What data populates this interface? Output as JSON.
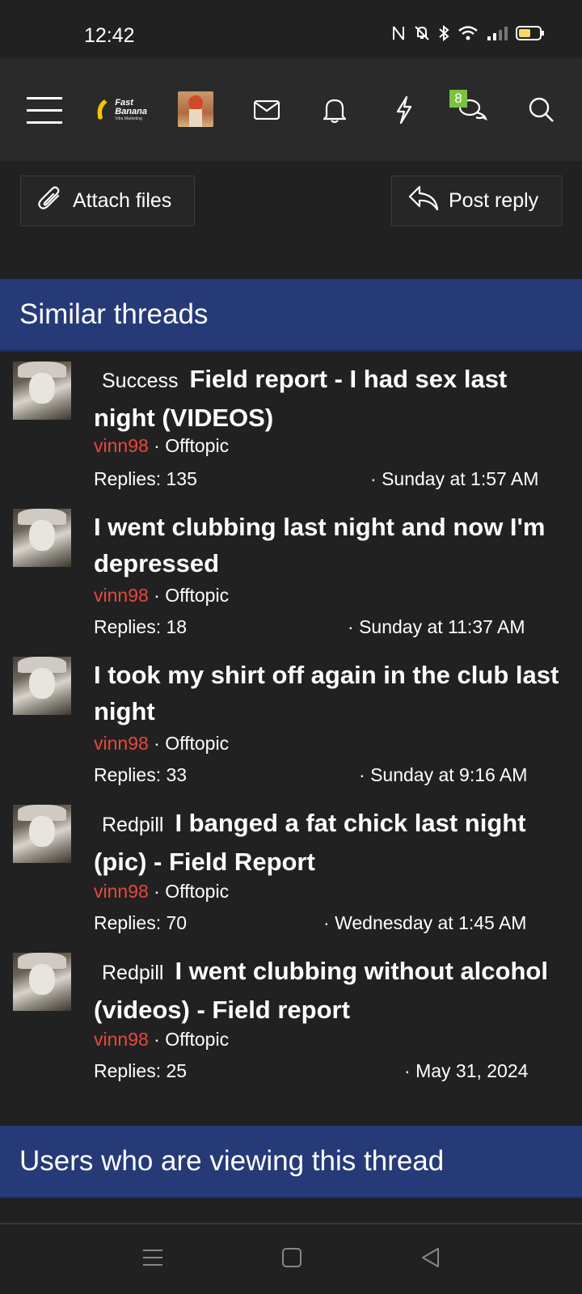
{
  "status_bar": {
    "time": "12:42",
    "icons": [
      "nfc-icon",
      "mute-icon",
      "bluetooth-icon",
      "wifi-icon",
      "signal-icon",
      "battery-icon"
    ]
  },
  "navbar": {
    "logo_text": "Fast Banana",
    "logo_subtext": "Vitra Marketing",
    "conversations_badge": "8",
    "icons": [
      "menu-icon",
      "inbox-icon",
      "bell-icon",
      "lightning-icon",
      "conversations-icon",
      "search-icon"
    ]
  },
  "actions": {
    "attach_files": "Attach files",
    "post_reply": "Post reply"
  },
  "similar_threads": {
    "heading": "Similar threads",
    "threads": [
      {
        "prefix": "Success",
        "title": "Field report - I had sex last night (VIDEOS)",
        "author": "vinn98",
        "forum": "Offtopic",
        "replies": "Replies: 135",
        "date": "Sunday at 1:57 AM"
      },
      {
        "prefix": "",
        "title": "I went clubbing last night and now I'm depressed",
        "author": "vinn98",
        "forum": "Offtopic",
        "replies": "Replies: 18",
        "date": "Sunday at 11:37 AM"
      },
      {
        "prefix": "",
        "title": "I took my shirt off again in the club last night",
        "author": "vinn98",
        "forum": "Offtopic",
        "replies": "Replies: 33",
        "date": "Sunday at 9:16 AM"
      },
      {
        "prefix": "Redpill",
        "title": "I banged a fat chick last night (pic) - Field Report",
        "author": "vinn98",
        "forum": "Offtopic",
        "replies": "Replies: 70",
        "date": "Wednesday at 1:45 AM"
      },
      {
        "prefix": "Redpill",
        "title": "I went clubbing without alcohol (videos) - Field report",
        "author": "vinn98",
        "forum": "Offtopic",
        "replies": "Replies: 25",
        "date": "May 31, 2024"
      }
    ]
  },
  "users_viewing": {
    "heading": "Users who are viewing this thread"
  },
  "colors": {
    "background": "#212121",
    "navbar": "#2a2a2a",
    "block_header": "#263a78",
    "author": "#e8483c",
    "badge": "#7cc142"
  }
}
